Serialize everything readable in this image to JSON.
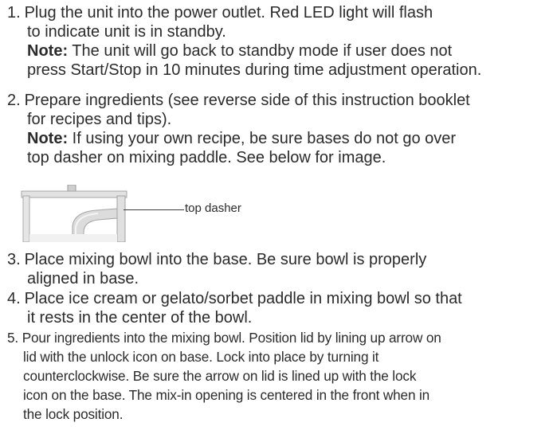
{
  "steps": [
    {
      "number": "1.",
      "line1": "Plug the unit into the power outlet. Red LED light will flash",
      "line2": "to indicate unit is in standby.",
      "note_label": "Note:",
      "note_line1": " The unit will go back to standby mode if user does not",
      "note_line2": "press Start/Stop in 10 minutes during time adjustment operation."
    },
    {
      "number": "2.",
      "line1": "Prepare ingredients (see reverse side of this instruction booklet",
      "line2": "for recipes and tips).",
      "note_label": "Note:",
      "note_line1": " If using your own recipe, be sure bases do not go over",
      "note_line2": "top dasher on mixing paddle. See below for image."
    },
    {
      "number": "3.",
      "line1": "Place mixing bowl into the base. Be sure bowl is properly",
      "line2": "aligned in base."
    },
    {
      "number": "4.",
      "line1": "Place ice cream or gelato/sorbet paddle in mixing bowl so that",
      "line2": "it rests in the center of the bowl."
    },
    {
      "number": "5.",
      "line1": "Pour ingredients into the mixing bowl. Position lid by lining up arrow on",
      "line2": "lid with the unlock icon on base. Lock into place by turning it",
      "line3": "counterclockwise. Be sure the arrow on lid is lined up with the lock",
      "line4": "icon on the base. The mix-in opening is centered in the front when in",
      "line5": "the lock position."
    }
  ],
  "figure": {
    "label": "top dasher",
    "icon": "mixing-paddle-image"
  }
}
